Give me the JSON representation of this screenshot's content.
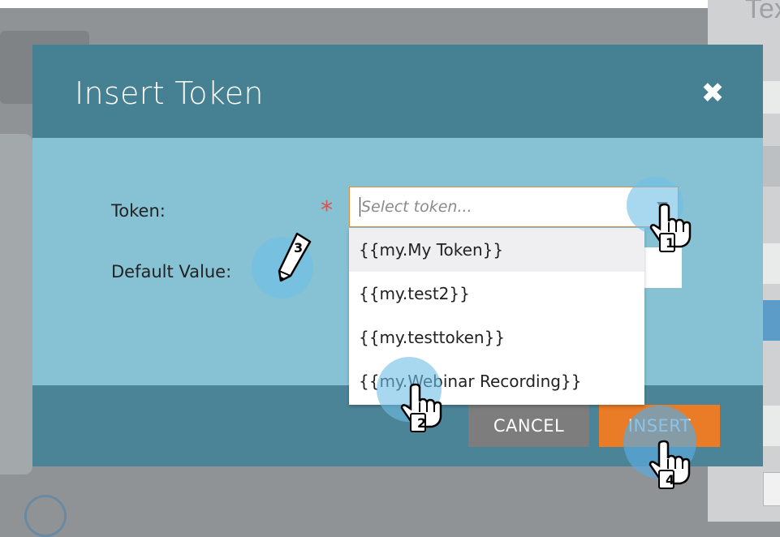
{
  "background": {
    "right_heading": "Tex"
  },
  "modal": {
    "title": "Insert Token",
    "token_label": "Token:",
    "default_value_label": "Default Value:",
    "required_mark": "*",
    "token_placeholder": "Select token...",
    "dropdown_options": [
      "{{my.My Token}}",
      "{{my.test2}}",
      "{{my.testtoken}}",
      "{{my.Webinar Recording}}"
    ],
    "cancel_label": "CANCEL",
    "insert_label": "INSERT"
  },
  "tutorial_steps": [
    "1",
    "2",
    "3",
    "4"
  ],
  "colors": {
    "header": "#458192",
    "body": "#87c2d4",
    "footer": "#4c8497",
    "insert": "#ea7b27",
    "cancel": "#7d7d7d"
  }
}
